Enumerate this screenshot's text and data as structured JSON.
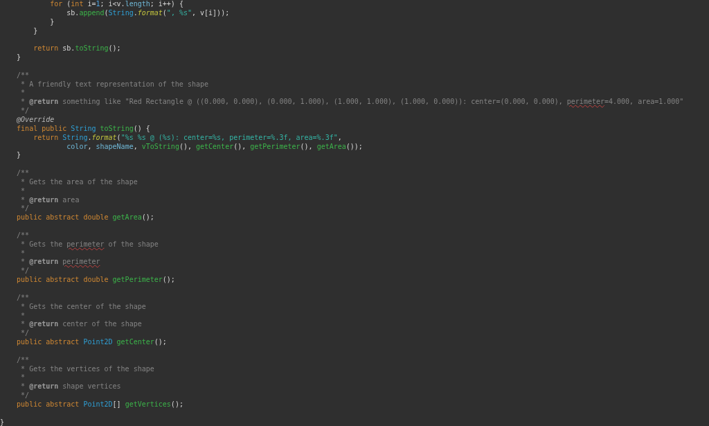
{
  "editor": {
    "lines": [
      {
        "kind": "code",
        "tokens": [
          {
            "kind": "keyword",
            "text": "            for"
          },
          {
            "kind": "plain",
            "text": " ("
          },
          {
            "kind": "keyword",
            "text": "int"
          },
          {
            "kind": "plain",
            "text": " i="
          },
          {
            "kind": "number",
            "text": "1"
          },
          {
            "kind": "plain",
            "text": "; i<v."
          },
          {
            "kind": "field",
            "text": "length"
          },
          {
            "kind": "plain",
            "text": "; i++) {"
          }
        ]
      },
      {
        "kind": "code",
        "tokens": [
          {
            "kind": "plain",
            "text": "                sb."
          },
          {
            "kind": "method",
            "text": "append"
          },
          {
            "kind": "plain",
            "text": "("
          },
          {
            "kind": "type",
            "text": "String"
          },
          {
            "kind": "plain",
            "text": "."
          },
          {
            "kind": "static",
            "text": "format"
          },
          {
            "kind": "plain",
            "text": "("
          },
          {
            "kind": "string",
            "text": "\", %s\""
          },
          {
            "kind": "plain",
            "text": ", v[i]));"
          }
        ]
      },
      {
        "kind": "code",
        "tokens": [
          {
            "kind": "plain",
            "text": "            }"
          }
        ]
      },
      {
        "kind": "code",
        "tokens": [
          {
            "kind": "plain",
            "text": "        }"
          }
        ]
      },
      {
        "kind": "blank"
      },
      {
        "kind": "code",
        "tokens": [
          {
            "kind": "keyword",
            "text": "        return"
          },
          {
            "kind": "plain",
            "text": " sb."
          },
          {
            "kind": "method",
            "text": "toString"
          },
          {
            "kind": "plain",
            "text": "();"
          }
        ]
      },
      {
        "kind": "code",
        "tokens": [
          {
            "kind": "plain",
            "text": "    }"
          }
        ]
      },
      {
        "kind": "blank"
      },
      {
        "kind": "code",
        "tokens": [
          {
            "kind": "comment",
            "text": "    /**"
          }
        ]
      },
      {
        "kind": "code",
        "tokens": [
          {
            "kind": "comment",
            "text": "     * A friendly text representation of the shape"
          }
        ]
      },
      {
        "kind": "code",
        "tokens": [
          {
            "kind": "comment",
            "text": "     *"
          }
        ]
      },
      {
        "kind": "code",
        "tokens": [
          {
            "kind": "comment",
            "text": "     * "
          },
          {
            "kind": "doctag",
            "text": "@return"
          },
          {
            "kind": "comment",
            "text": " something like \"Red Rectangle @ ((0.000, 0.000), (0.000, 1.000), (1.000, 1.000), (1.000, 0.000)): center=(0.000, 0.000), "
          },
          {
            "kind": "typo",
            "text": "perimeter"
          },
          {
            "kind": "comment",
            "text": "=4.000, area=1.000\""
          }
        ]
      },
      {
        "kind": "code",
        "tokens": [
          {
            "kind": "comment",
            "text": "     */"
          }
        ]
      },
      {
        "kind": "code",
        "tokens": [
          {
            "kind": "annotation",
            "text": "    @Override"
          }
        ]
      },
      {
        "kind": "code",
        "tokens": [
          {
            "kind": "keyword",
            "text": "    final public "
          },
          {
            "kind": "type",
            "text": "String "
          },
          {
            "kind": "method",
            "text": "toString"
          },
          {
            "kind": "plain",
            "text": "() {"
          }
        ]
      },
      {
        "kind": "code",
        "tokens": [
          {
            "kind": "keyword",
            "text": "        return "
          },
          {
            "kind": "type",
            "text": "String"
          },
          {
            "kind": "plain",
            "text": "."
          },
          {
            "kind": "static",
            "text": "format"
          },
          {
            "kind": "plain",
            "text": "("
          },
          {
            "kind": "string",
            "text": "\"%s %s @ (%s): center=%s, perimeter=%.3f, area=%.3f\""
          },
          {
            "kind": "plain",
            "text": ","
          }
        ]
      },
      {
        "kind": "code",
        "tokens": [
          {
            "kind": "field",
            "text": "                color"
          },
          {
            "kind": "plain",
            "text": ", "
          },
          {
            "kind": "field",
            "text": "shapeName"
          },
          {
            "kind": "plain",
            "text": ", "
          },
          {
            "kind": "method",
            "text": "vToString"
          },
          {
            "kind": "plain",
            "text": "(), "
          },
          {
            "kind": "method",
            "text": "getCenter"
          },
          {
            "kind": "plain",
            "text": "(), "
          },
          {
            "kind": "method",
            "text": "getPerimeter"
          },
          {
            "kind": "plain",
            "text": "(), "
          },
          {
            "kind": "method",
            "text": "getArea"
          },
          {
            "kind": "plain",
            "text": "());"
          }
        ]
      },
      {
        "kind": "code",
        "tokens": [
          {
            "kind": "plain",
            "text": "    }"
          }
        ]
      },
      {
        "kind": "blank"
      },
      {
        "kind": "code",
        "tokens": [
          {
            "kind": "comment",
            "text": "    /**"
          }
        ]
      },
      {
        "kind": "code",
        "tokens": [
          {
            "kind": "comment",
            "text": "     * Gets the area of the shape"
          }
        ]
      },
      {
        "kind": "code",
        "tokens": [
          {
            "kind": "comment",
            "text": "     *"
          }
        ]
      },
      {
        "kind": "code",
        "tokens": [
          {
            "kind": "comment",
            "text": "     * "
          },
          {
            "kind": "doctag",
            "text": "@return"
          },
          {
            "kind": "comment",
            "text": " area"
          }
        ]
      },
      {
        "kind": "code",
        "tokens": [
          {
            "kind": "comment",
            "text": "     */"
          }
        ]
      },
      {
        "kind": "code",
        "tokens": [
          {
            "kind": "keyword",
            "text": "    public abstract double "
          },
          {
            "kind": "method",
            "text": "getArea"
          },
          {
            "kind": "plain",
            "text": "();"
          }
        ]
      },
      {
        "kind": "blank"
      },
      {
        "kind": "code",
        "tokens": [
          {
            "kind": "comment",
            "text": "    /**"
          }
        ]
      },
      {
        "kind": "code",
        "tokens": [
          {
            "kind": "comment",
            "text": "     * Gets the "
          },
          {
            "kind": "typo",
            "text": "perimeter"
          },
          {
            "kind": "comment",
            "text": " of the shape"
          }
        ]
      },
      {
        "kind": "code",
        "tokens": [
          {
            "kind": "comment",
            "text": "     *"
          }
        ]
      },
      {
        "kind": "code",
        "tokens": [
          {
            "kind": "comment",
            "text": "     * "
          },
          {
            "kind": "doctag",
            "text": "@return "
          },
          {
            "kind": "typo",
            "text": "perimeter"
          }
        ]
      },
      {
        "kind": "code",
        "tokens": [
          {
            "kind": "comment",
            "text": "     */"
          }
        ]
      },
      {
        "kind": "code",
        "tokens": [
          {
            "kind": "keyword",
            "text": "    public abstract double "
          },
          {
            "kind": "method",
            "text": "getPerimeter"
          },
          {
            "kind": "plain",
            "text": "();"
          }
        ]
      },
      {
        "kind": "blank"
      },
      {
        "kind": "code",
        "tokens": [
          {
            "kind": "comment",
            "text": "    /**"
          }
        ]
      },
      {
        "kind": "code",
        "tokens": [
          {
            "kind": "comment",
            "text": "     * Gets the center of the shape"
          }
        ]
      },
      {
        "kind": "code",
        "tokens": [
          {
            "kind": "comment",
            "text": "     *"
          }
        ]
      },
      {
        "kind": "code",
        "tokens": [
          {
            "kind": "comment",
            "text": "     * "
          },
          {
            "kind": "doctag",
            "text": "@return"
          },
          {
            "kind": "comment",
            "text": " center of the shape"
          }
        ]
      },
      {
        "kind": "code",
        "tokens": [
          {
            "kind": "comment",
            "text": "     */"
          }
        ]
      },
      {
        "kind": "code",
        "tokens": [
          {
            "kind": "keyword",
            "text": "    public abstract "
          },
          {
            "kind": "type",
            "text": "Point2D "
          },
          {
            "kind": "method",
            "text": "getCenter"
          },
          {
            "kind": "plain",
            "text": "();"
          }
        ]
      },
      {
        "kind": "blank"
      },
      {
        "kind": "code",
        "tokens": [
          {
            "kind": "comment",
            "text": "    /**"
          }
        ]
      },
      {
        "kind": "code",
        "tokens": [
          {
            "kind": "comment",
            "text": "     * Gets the vertices of the shape"
          }
        ]
      },
      {
        "kind": "code",
        "tokens": [
          {
            "kind": "comment",
            "text": "     *"
          }
        ]
      },
      {
        "kind": "code",
        "tokens": [
          {
            "kind": "comment",
            "text": "     * "
          },
          {
            "kind": "doctag",
            "text": "@return"
          },
          {
            "kind": "comment",
            "text": " shape vertices"
          }
        ]
      },
      {
        "kind": "code",
        "tokens": [
          {
            "kind": "comment",
            "text": "     */"
          }
        ]
      },
      {
        "kind": "code",
        "tokens": [
          {
            "kind": "keyword",
            "text": "    public abstract "
          },
          {
            "kind": "type",
            "text": "Point2D"
          },
          {
            "kind": "plain",
            "text": "[] "
          },
          {
            "kind": "method",
            "text": "getVertices"
          },
          {
            "kind": "plain",
            "text": "();"
          }
        ]
      },
      {
        "kind": "blank"
      },
      {
        "kind": "code",
        "tokens": [
          {
            "kind": "plain",
            "text": "}"
          }
        ]
      }
    ]
  }
}
